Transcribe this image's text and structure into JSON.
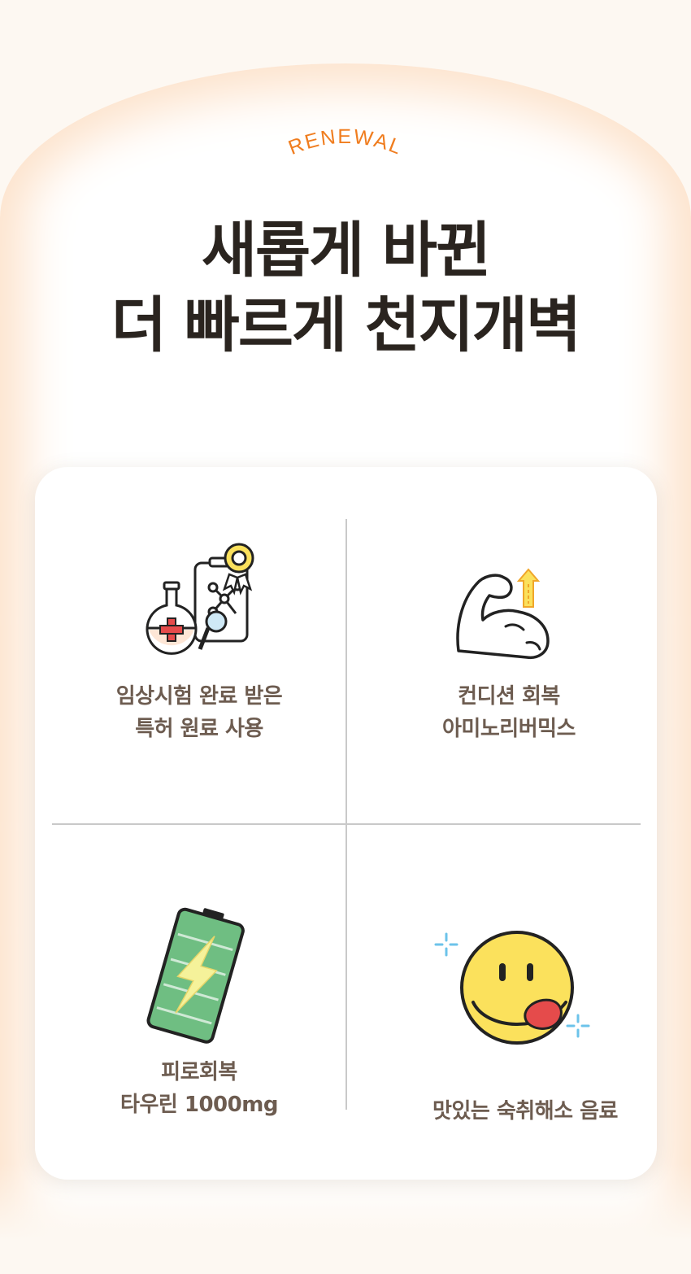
{
  "badge": "RENEWAL",
  "headline": {
    "line1": "새롭게 바뀐",
    "line2": "더 빠르게 천지개벽"
  },
  "features": [
    {
      "icon": "lab-flask-certificate-icon",
      "line1": "임상시험 완료 받은",
      "line2": "특허 원료 사용"
    },
    {
      "icon": "flexed-arm-muscle-icon",
      "line1": "컨디션 회복",
      "line2": "아미노리버믹스"
    },
    {
      "icon": "charging-battery-icon",
      "line1": "피로회복",
      "line2": "타우린 1000mg"
    },
    {
      "icon": "yummy-smiley-face-icon",
      "line1": "맛있는 숙취해소 음료"
    }
  ],
  "colors": {
    "accent": "#f07d1f",
    "headline": "#2a241f",
    "feature_text": "#6d5c50",
    "battery_green": "#6fbe82",
    "smiley_yellow": "#fbe15c",
    "sparkle_blue": "#6cc3ea",
    "cross_red": "#e54b4b"
  }
}
